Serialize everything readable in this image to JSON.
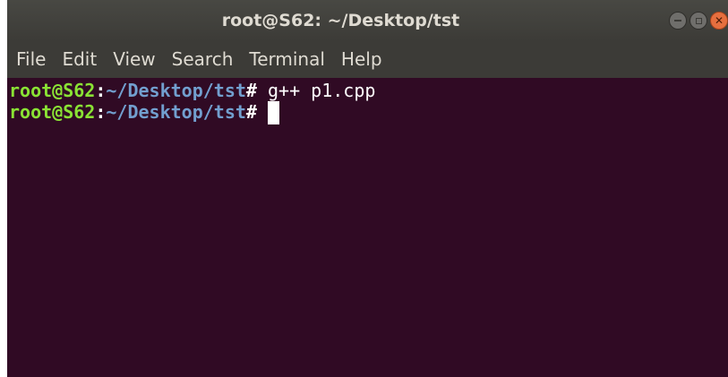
{
  "window": {
    "title": "root@S62: ~/Desktop/tst"
  },
  "menu": {
    "items": [
      "File",
      "Edit",
      "View",
      "Search",
      "Terminal",
      "Help"
    ]
  },
  "terminal": {
    "lines": [
      {
        "user": "root@S62",
        "sep": ":",
        "path": "~/Desktop/tst",
        "hash": "#",
        "command": " g++ p1.cpp"
      },
      {
        "user": "root@S62",
        "sep": ":",
        "path": "~/Desktop/tst",
        "hash": "#",
        "command": ""
      }
    ]
  },
  "colors": {
    "terminal_bg": "#300a24",
    "prompt_user": "#8ae234",
    "prompt_path": "#729fcf",
    "close_button": "#e66f3f"
  }
}
